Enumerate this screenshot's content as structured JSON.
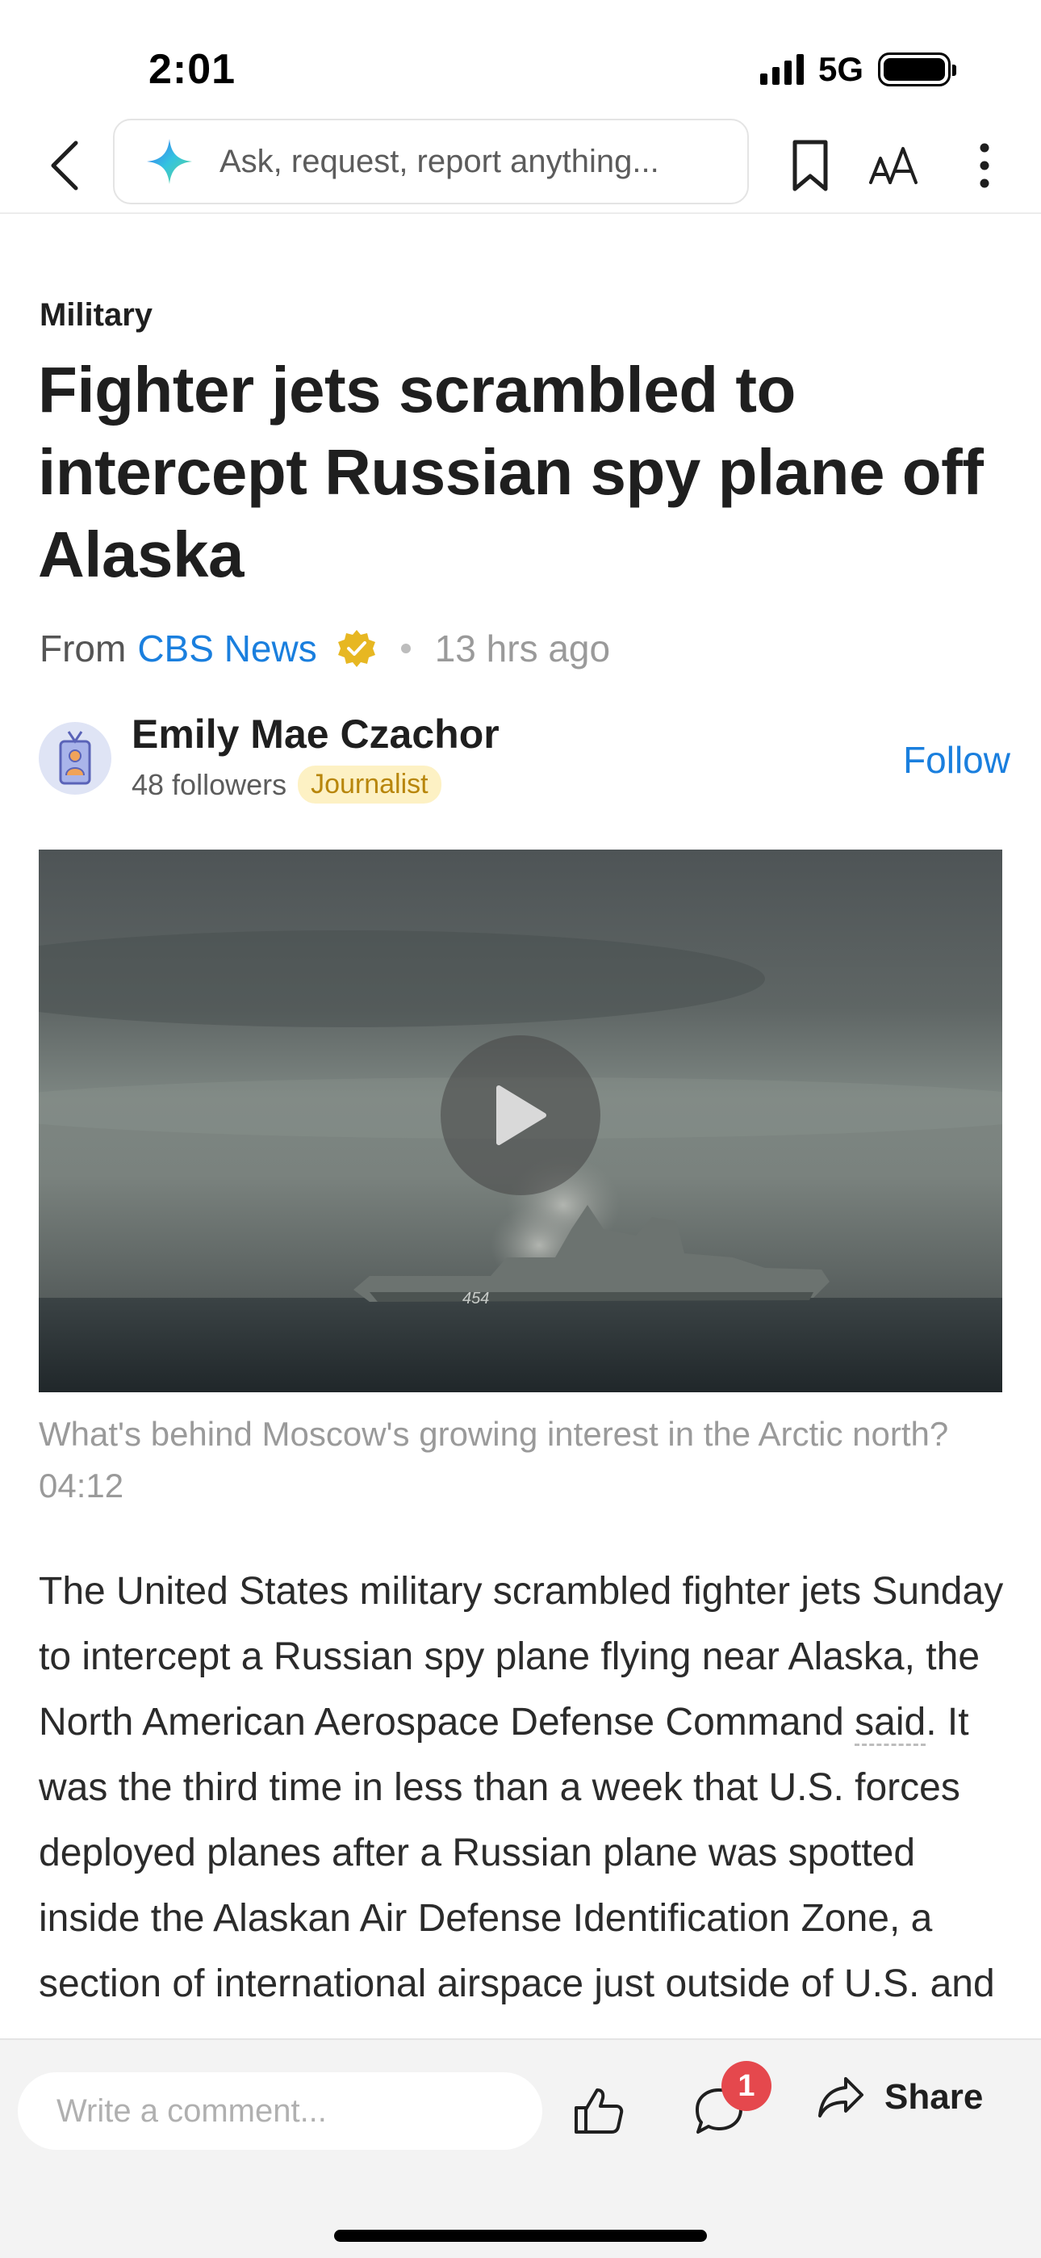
{
  "status_bar": {
    "time": "2:01",
    "network": "5G"
  },
  "toolbar": {
    "search_placeholder": "Ask, request, report anything..."
  },
  "article": {
    "category": "Military",
    "headline": "Fighter jets scrambled to intercept Russian spy plane off Alaska",
    "source_prefix": "From",
    "source_name": "CBS News",
    "time_ago": "13 hrs ago",
    "author": {
      "name": "Emily Mae Czachor",
      "followers": "48 followers",
      "badge": "Journalist",
      "follow_label": "Follow"
    },
    "video": {
      "caption": "What's behind Moscow's growing interest in the Arctic north? 04:12",
      "hull_number": "454"
    },
    "body": {
      "before_link": "The United States military scrambled fighter jets Sunday to intercept a Russian spy plane flying near Alaska, the North American Aerospace Defense Command ",
      "link_text": "said",
      "after_link": ". It was the third time in less than a week that U.S. forces deployed planes after a Russian plane was spotted inside the Alaskan Air Defense Identification Zone, a section of international airspace just outside of U.S. and"
    }
  },
  "bottom_bar": {
    "comment_placeholder": "Write a comment...",
    "comment_count": "1",
    "share_label": "Share"
  },
  "colors": {
    "accent": "#1a7fde",
    "badge_bg": "#fdf1c4",
    "badge_text": "#b8860b",
    "notification": "#e5484d"
  }
}
